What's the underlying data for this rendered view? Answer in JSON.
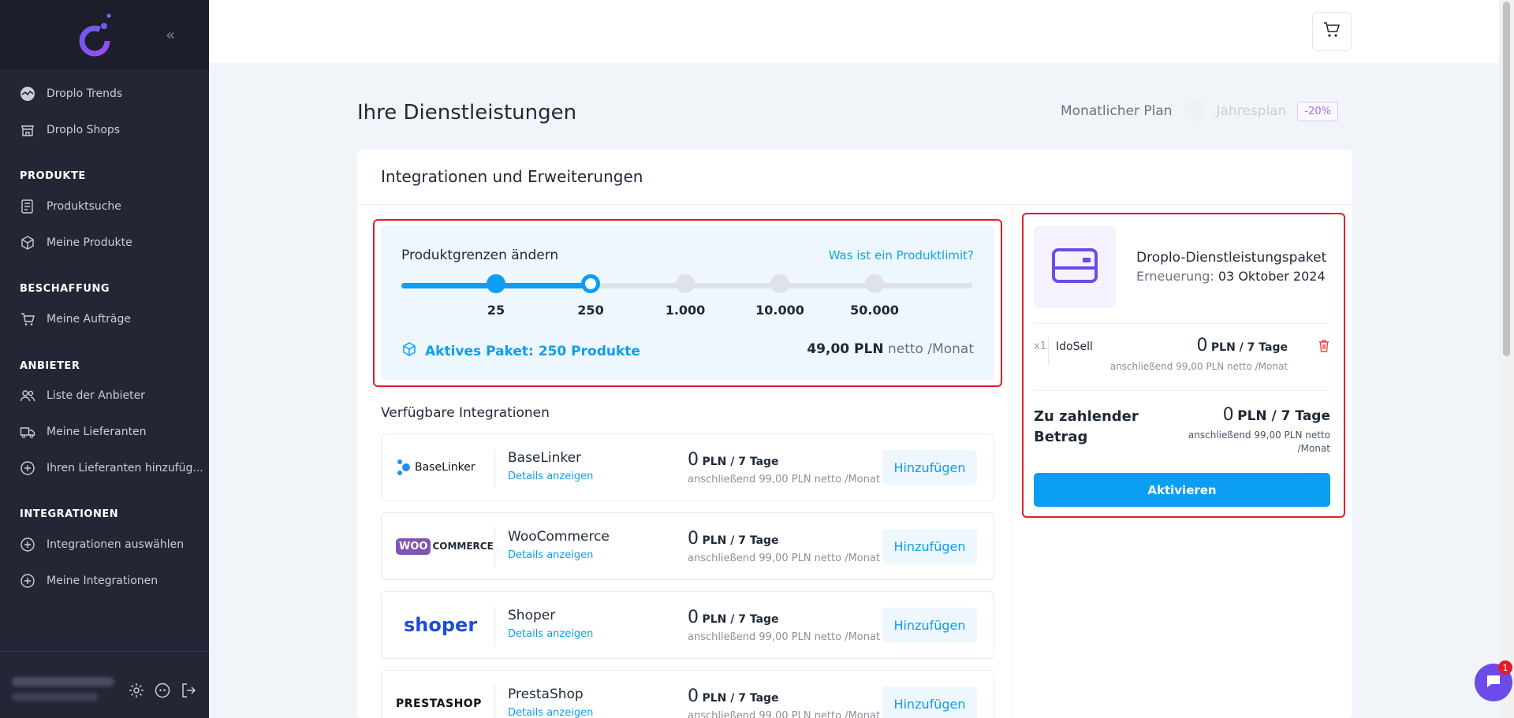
{
  "sidebar": {
    "items": [
      {
        "label": "Droplo Trends",
        "icon": "trends-icon"
      },
      {
        "label": "Droplo Shops",
        "icon": "store-icon"
      }
    ],
    "sections": [
      {
        "title": "PRODUKTE",
        "items": [
          {
            "label": "Produktsuche",
            "icon": "list-search-icon"
          },
          {
            "label": "Meine Produkte",
            "icon": "box-icon"
          }
        ]
      },
      {
        "title": "BESCHAFFUNG",
        "items": [
          {
            "label": "Meine Aufträge",
            "icon": "cart-icon"
          }
        ]
      },
      {
        "title": "ANBIETER",
        "items": [
          {
            "label": "Liste der Anbieter",
            "icon": "users-icon"
          },
          {
            "label": "Meine Lieferanten",
            "icon": "truck-icon"
          },
          {
            "label": "Ihren Lieferanten hinzufüg...",
            "icon": "plus-circle-icon"
          }
        ]
      },
      {
        "title": "INTEGRATIONEN",
        "items": [
          {
            "label": "Integrationen auswählen",
            "icon": "plus-circle-icon"
          },
          {
            "label": "Meine Integrationen",
            "icon": "plus-circle-icon"
          }
        ]
      }
    ]
  },
  "header": {
    "page_title": "Ihre Dienstleistungen",
    "plan_monthly": "Monatlicher Plan",
    "plan_yearly": "Jahresplan",
    "discount": "-20%"
  },
  "card": {
    "title": "Integrationen und Erweiterungen"
  },
  "limits": {
    "title": "Produktgrenzen ändern",
    "help_link": "Was ist ein Produktlimit?",
    "stops": [
      "25",
      "250",
      "1.000",
      "10.000",
      "50.000"
    ],
    "selected_index": 1,
    "active_package": "Aktives Paket: 250 Produkte",
    "price_amount": "49,00 PLN",
    "price_suffix": "netto /Monat"
  },
  "integrations": {
    "title": "Verfügbare Integrationen",
    "details_label": "Details anzeigen",
    "add_label": "Hinzufügen",
    "price_big": "0",
    "price_unit": "PLN / 7 Tage",
    "price_sub": "anschließend 99,00 PLN netto /Monat",
    "items": [
      {
        "name": "BaseLinker",
        "logo": "BaseLinker"
      },
      {
        "name": "WooCommerce",
        "logo": "COMMERCE"
      },
      {
        "name": "Shoper",
        "logo": "shoper"
      },
      {
        "name": "PrestaShop",
        "logo": "PRESTASHOP"
      }
    ]
  },
  "summary": {
    "package_title": "Droplo-Dienstleistungspaket",
    "renewal_label": "Erneuerung:",
    "renewal_date": "03 Oktober 2024",
    "line_qty": "x1",
    "line_name": "IdoSell",
    "line_price_big": "0",
    "line_price_unit": "PLN / 7 Tage",
    "line_sub": "anschließend 99,00 PLN netto /Monat",
    "total_label": "Zu zahlender Betrag",
    "total_price_big": "0",
    "total_price_unit": "PLN / 7 Tage",
    "total_sub": "anschließend 99,00 PLN netto /Monat",
    "activate_label": "Aktivieren"
  },
  "chat": {
    "badge": "1"
  },
  "colors": {
    "accent": "#0c9ef2",
    "sidebar": "#242636",
    "highlight": "#e11d2a",
    "brand_purple": "#6d4be8"
  }
}
